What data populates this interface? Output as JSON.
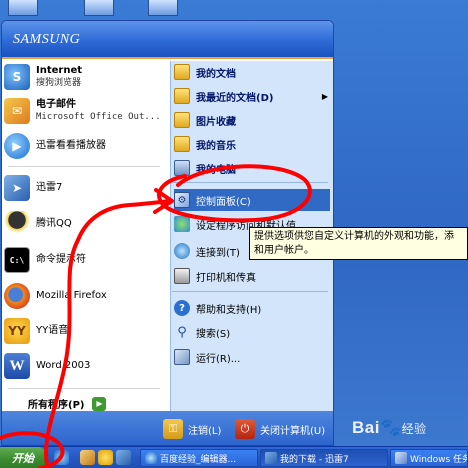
{
  "start_menu": {
    "username": "SAMSUNG",
    "left_items": [
      {
        "title": "Internet",
        "subtitle": "搜狗浏览器",
        "icon": "sogou-browser-icon"
      },
      {
        "title": "电子邮件",
        "subtitle": "Microsoft Office Out...",
        "icon": "outlook-icon"
      },
      {
        "title": "迅雷看看播放器",
        "subtitle": "",
        "icon": "xunlei-player-icon"
      },
      {
        "title": "迅雷7",
        "subtitle": "",
        "icon": "xunlei7-icon"
      },
      {
        "title": "腾讯QQ",
        "subtitle": "",
        "icon": "qq-icon"
      },
      {
        "title": "命令提示符",
        "subtitle": "",
        "icon": "cmd-icon"
      },
      {
        "title": "Mozilla Firefox",
        "subtitle": "",
        "icon": "firefox-icon"
      },
      {
        "title": "YY语音",
        "subtitle": "",
        "icon": "yy-icon"
      },
      {
        "title": "Word 2003",
        "subtitle": "",
        "icon": "word-icon"
      }
    ],
    "all_programs": "所有程序(P)",
    "right_items": [
      {
        "label": "我的文档",
        "icon": "folder-icon"
      },
      {
        "label": "我最近的文档(D)",
        "icon": "folder-icon",
        "submenu": true
      },
      {
        "label": "图片收藏",
        "icon": "folder-icon"
      },
      {
        "label": "我的音乐",
        "icon": "folder-icon"
      },
      {
        "label": "我的电脑",
        "icon": "computer-icon"
      },
      {
        "label": "控制面板(C)",
        "icon": "control-panel-icon",
        "highlighted": true
      },
      {
        "label": "设定程序访问和默认值",
        "icon": "default-programs-icon"
      },
      {
        "label": "连接到(T)",
        "icon": "network-icon"
      },
      {
        "label": "打印机和传真",
        "icon": "printer-icon"
      },
      {
        "label": "帮助和支持(H)",
        "icon": "help-icon"
      },
      {
        "label": "搜索(S)",
        "icon": "search-icon"
      },
      {
        "label": "运行(R)...",
        "icon": "run-icon"
      }
    ],
    "footer": {
      "logoff": "注销(L)",
      "shutdown": "关闭计算机(U)"
    }
  },
  "tooltip": {
    "line1": "提供选项供您自定义计算机的外观和功能，添",
    "line2": "和用户帐户。"
  },
  "taskbar": {
    "start_label": "开始",
    "tasks": [
      {
        "label": "百度经验_编辑器...",
        "icon": "ie-icon"
      },
      {
        "label": "我的下载 - 迅雷7",
        "icon": "xunlei7-icon"
      },
      {
        "label": "Windows 任务",
        "icon": "windows-task-icon"
      }
    ]
  },
  "watermark": {
    "brand": "Bai",
    "suffix": "经验"
  },
  "colors": {
    "highlight": "#316ac5",
    "header_blue": "#2f6bd7",
    "right_panel": "#d3e5fa",
    "annotation_red": "#ff0000",
    "start_green": "#3c8d2f"
  }
}
